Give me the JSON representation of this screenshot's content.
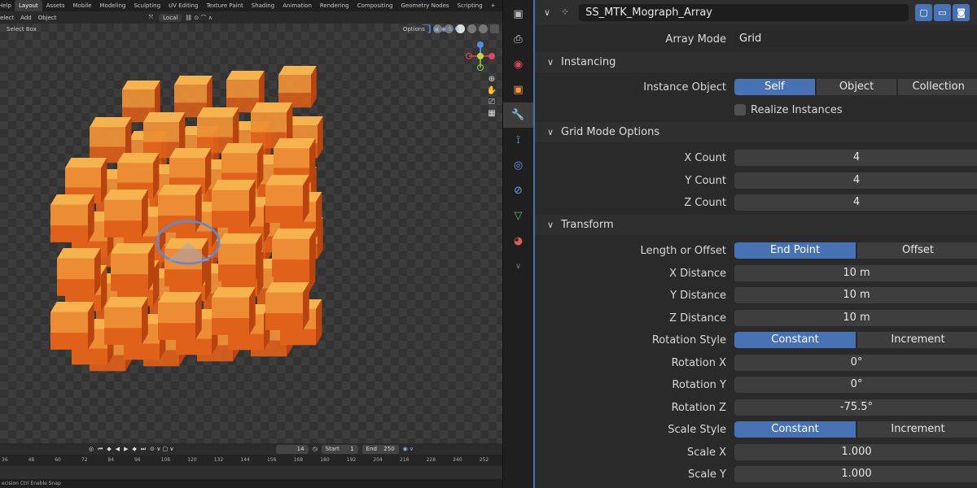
{
  "viewport": {
    "workspace_tabs": [
      "Layout",
      "Assets",
      "Mobile",
      "Modeling",
      "Sculpting",
      "UV Editing",
      "Texture Paint",
      "Shading",
      "Animation",
      "Rendering",
      "Compositing",
      "Geometry Nodes",
      "Scripting"
    ],
    "active_tab": "Layout",
    "help_label": "Help",
    "add_tab_label": "+",
    "header_menus": [
      "elect",
      "Add",
      "Object"
    ],
    "orientation_label": "Local",
    "select_mode_label": "Select Box",
    "options_label": "Options"
  },
  "timeline": {
    "current_frame": "14",
    "start_label": "Start",
    "start_value": "1",
    "end_label": "End",
    "end_value": "250",
    "ruler_ticks": [
      "36",
      "48",
      "60",
      "72",
      "84",
      "96",
      "108",
      "120",
      "132",
      "144",
      "156",
      "168",
      "180",
      "192",
      "204",
      "216",
      "228",
      "240",
      "252"
    ]
  },
  "statusbar": {
    "text": "ecision  Ctrl  Enable Snap"
  },
  "properties": {
    "modifier_name": "SS_MTK_Mograph_Array",
    "array_mode_label": "Array Mode",
    "array_mode_value": "Grid",
    "instancing": {
      "title": "Instancing",
      "instance_object_label": "Instance Object",
      "options": [
        "Self",
        "Object",
        "Collection"
      ],
      "selected": "Self",
      "realize_label": "Realize Instances"
    },
    "grid": {
      "title": "Grid Mode Options",
      "x_count_label": "X Count",
      "x_count": "4",
      "y_count_label": "Y Count",
      "y_count": "4",
      "z_count_label": "Z Count",
      "z_count": "4"
    },
    "transform": {
      "title": "Transform",
      "length_label": "Length or Offset",
      "length_options": [
        "End Point",
        "Offset"
      ],
      "x_distance_label": "X Distance",
      "x_distance": "10 m",
      "y_distance_label": "Y Distance",
      "y_distance": "10 m",
      "z_distance_label": "Z Distance",
      "z_distance": "10 m",
      "rotation_style_label": "Rotation Style",
      "rotation_style_options": [
        "Constant",
        "Increment"
      ],
      "rotation_x_label": "Rotation X",
      "rotation_x": "0°",
      "rotation_y_label": "Rotation Y",
      "rotation_y": "0°",
      "rotation_z_label": "Rotation Z",
      "rotation_z": "-75.5°",
      "scale_style_label": "Scale Style",
      "scale_style_options": [
        "Constant",
        "Increment"
      ],
      "scale_x_label": "Scale X",
      "scale_x": "1.000",
      "scale_y_label": "Scale Y",
      "scale_y": "1.000"
    }
  },
  "colors": {
    "accent": "#4772b3",
    "cube_top": "#f6b24c",
    "cube_side": "#e0611a"
  }
}
